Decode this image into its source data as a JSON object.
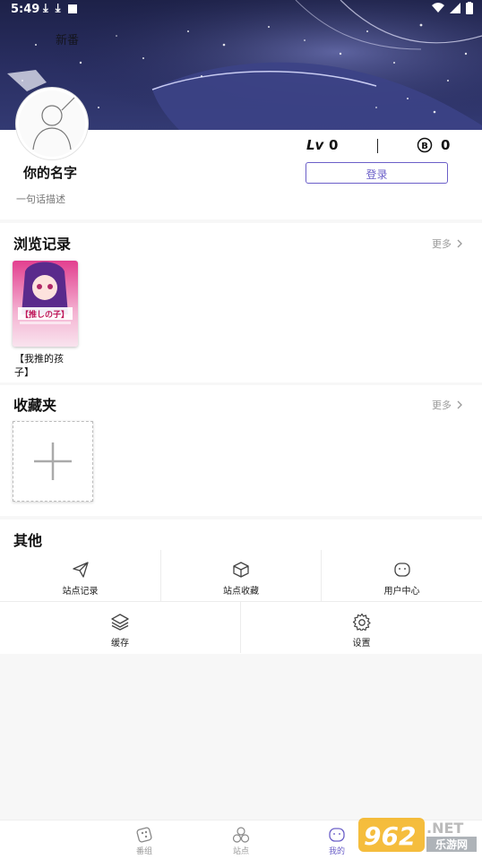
{
  "status_bar": {
    "time": "5:49"
  },
  "banner": {
    "title": "新番"
  },
  "profile": {
    "name": "你的名字",
    "bio": "一句话描述",
    "level_label": "Lv",
    "level_value": "0",
    "coin_value": "0",
    "login_label": "登录"
  },
  "history": {
    "title": "浏览记录",
    "more_label": "更多",
    "items": [
      {
        "title": "【我推的孩子】",
        "cover_text": "【推しの子】"
      }
    ]
  },
  "favorites": {
    "title": "收藏夹",
    "more_label": "更多"
  },
  "others": {
    "title": "其他",
    "items": [
      {
        "label": "站点记录",
        "icon": "paper-plane-icon"
      },
      {
        "label": "站点收藏",
        "icon": "box-icon"
      },
      {
        "label": "用户中心",
        "icon": "user-face-icon"
      },
      {
        "label": "缓存",
        "icon": "layers-icon"
      },
      {
        "label": "设置",
        "icon": "gear-icon"
      }
    ]
  },
  "bottom_nav": {
    "items": [
      {
        "label": "番组",
        "icon": "dice-icon",
        "active": false
      },
      {
        "label": "站点",
        "icon": "circles-icon",
        "active": false
      },
      {
        "label": "我的",
        "icon": "user-face-icon",
        "active": true
      }
    ]
  },
  "watermark": {
    "brand": "962",
    "tld": ".NET",
    "name": "乐游网"
  },
  "colors": {
    "accent": "#6b5fc8",
    "banner": "#1d2148"
  }
}
